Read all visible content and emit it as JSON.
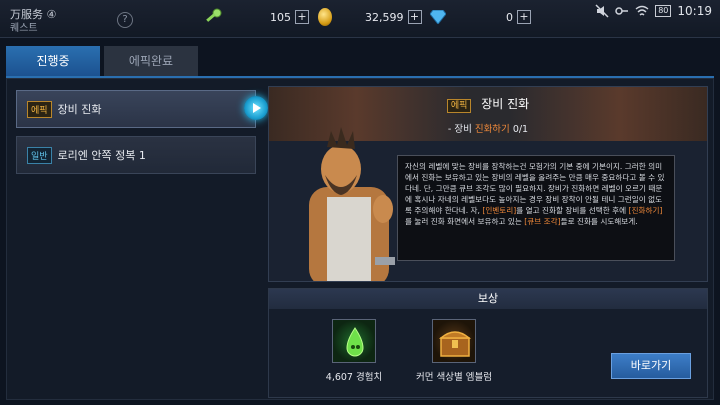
{
  "header": {
    "zone_name": "万服务 ④",
    "quest_label": "퀘스트",
    "help_glyph": "?",
    "keys": "105",
    "gold": "32,599",
    "gems": "0",
    "plus": "+",
    "battery": "80",
    "time": "10:19",
    "icons": [
      "key-icon",
      "gold-coin-icon",
      "gem-icon",
      "mute-icon",
      "vpn-key-icon",
      "wifi-icon",
      "battery-icon"
    ]
  },
  "tabs": [
    {
      "label": "진행중"
    },
    {
      "label": "에픽완료"
    }
  ],
  "quests": [
    {
      "badge": "에픽",
      "title": "장비 진화"
    },
    {
      "badge": "일반",
      "title": "로리엔 안쪽 정복 1"
    }
  ],
  "detail": {
    "badge": "에픽",
    "title": "장비 진화",
    "objective_prefix": "- 장비 ",
    "objective_highlight": "진화하기",
    "objective_progress": " 0/1",
    "dialog_part1": "자신의 레벨에 맞는 장비를 장착하는건 모험가의 기본 중에 기본이지. 그러한 의미에서 진화는 보유하고 있는 장비의 레벨을 올려주는 만큼 매우 중요하다고 볼 수 있다네. 단, 그만큼 큐브 조각도 많이 필요하지. 장비가 진화하면 레벨이 오르기 때문에 혹시나 자네의 레벨보다도 높아지는 경우 장비 장착이 안될 테니 그런일이 없도록 주의해야 한다네. 자, ",
    "dialog_hl1": "[인벤토리]",
    "dialog_part2": "를 열고 진화할 장비를 선택한 후에 ",
    "dialog_hl2": "[진화하기]",
    "dialog_part3": "를 눌러 진화 화면에서 보유하고 있는 ",
    "dialog_hl3": "[큐브 조각]",
    "dialog_part4": "들로 진화를 시도해보게."
  },
  "reward": {
    "header": "보상",
    "items": [
      {
        "label": "4,607 경험치",
        "icon": "exp-potion-icon"
      },
      {
        "label": "커먼 색상별 엠블럼",
        "icon": "treasure-chest-icon"
      }
    ],
    "go_button": "바로가기"
  },
  "colors": {
    "accent": "#2a6fb0",
    "epic": "#f2b441",
    "normal": "#5fc0e8",
    "highlight": "#f28a3a"
  }
}
